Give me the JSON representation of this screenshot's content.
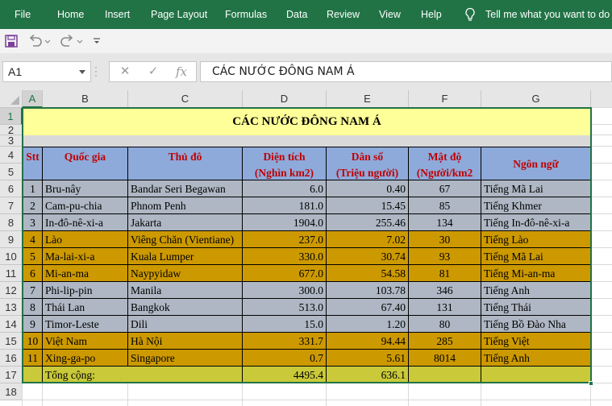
{
  "ribbon": {
    "tabs": [
      "File",
      "Home",
      "Insert",
      "Page Layout",
      "Formulas",
      "Data",
      "Review",
      "View",
      "Help"
    ],
    "tell_me": "Tell me what you want to do"
  },
  "quick_access": {
    "icons": [
      "save-icon",
      "undo-icon",
      "redo-icon",
      "customize-icon"
    ]
  },
  "formula_bar": {
    "name_box": "A1",
    "fx_label": "fx",
    "content": "CÁC NƯỚC ĐÔNG NAM Á"
  },
  "sheet": {
    "columns": [
      "A",
      "B",
      "C",
      "D",
      "E",
      "F",
      "G"
    ],
    "rows": [
      "1",
      "2",
      "3",
      "4",
      "5",
      "6",
      "7",
      "8",
      "9",
      "10",
      "11",
      "12",
      "13",
      "14",
      "15",
      "16",
      "17",
      "18"
    ],
    "title": "CÁC NƯỚC ĐÔNG NAM Á",
    "headers": {
      "stt": "Stt",
      "country": "Quốc gia",
      "capital": "Thủ đô",
      "area_1": "Diện tích",
      "area_2": "(Nghìn km2)",
      "pop_1": "Dân số",
      "pop_2": "(Triệu người)",
      "density_1": "Mật độ",
      "density_2": "(Người/km2",
      "language": "Ngôn ngữ"
    },
    "rows_data": [
      {
        "stt": "1",
        "country": "Bru-nây",
        "capital": "Bandar Seri Begawan",
        "area": "6.0",
        "pop": "0.40",
        "density": "67",
        "lang": "Tiếng Mã Lai"
      },
      {
        "stt": "2",
        "country": "Cam-pu-chia",
        "capital": "Phnom Penh",
        "area": "181.0",
        "pop": "15.45",
        "density": "85",
        "lang": "Tiếng Khmer"
      },
      {
        "stt": "3",
        "country": "In-đô-nê-xi-a",
        "capital": "Jakarta",
        "area": "1904.0",
        "pop": "255.46",
        "density": "134",
        "lang": "Tiếng In-đô-nê-xi-a"
      },
      {
        "stt": "4",
        "country": "Lào",
        "capital": "Viêng Chăn (Vientiane)",
        "area": "237.0",
        "pop": "7.02",
        "density": "30",
        "lang": "Tiếng Lào"
      },
      {
        "stt": "5",
        "country": "Ma-lai-xi-a",
        "capital": "Kuala Lumper",
        "area": "330.0",
        "pop": "30.74",
        "density": "93",
        "lang": "Tiếng Mã Lai"
      },
      {
        "stt": "6",
        "country": "Mi-an-ma",
        "capital": "Naypyidaw",
        "area": "677.0",
        "pop": "54.58",
        "density": "81",
        "lang": "Tiếng Mi-an-ma"
      },
      {
        "stt": "7",
        "country": "Phi-lip-pin",
        "capital": "Manila",
        "area": "300.0",
        "pop": "103.78",
        "density": "346",
        "lang": "Tiếng Anh"
      },
      {
        "stt": "8",
        "country": "Thái Lan",
        "capital": "Bangkok",
        "area": "513.0",
        "pop": "67.40",
        "density": "131",
        "lang": "Tiếng Thái"
      },
      {
        "stt": "9",
        "country": "Timor-Leste",
        "capital": "Dili",
        "area": "15.0",
        "pop": "1.20",
        "density": "80",
        "lang": "Tiếng Bồ Đào Nha"
      },
      {
        "stt": "10",
        "country": "Việt Nam",
        "capital": "Hà Nội",
        "area": "331.7",
        "pop": "94.44",
        "density": "285",
        "lang": "Tiếng Việt"
      },
      {
        "stt": "11",
        "country": "Xing-ga-po",
        "capital": "Singapore",
        "area": "0.7",
        "pop": "5.61",
        "density": "8014",
        "lang": "Tiếng Anh"
      }
    ],
    "total": {
      "label": "Tổng cộng:",
      "area": "4495.4",
      "pop": "636.1"
    }
  },
  "colors": {
    "excel_green": "#217346",
    "header_blue": "#8eaadb",
    "row_gray": "#aeb7c3",
    "row_orange": "#cc9900",
    "title_yellow": "#ffff99",
    "total_olive": "#c9c93a",
    "header_text_red": "#c00000"
  }
}
